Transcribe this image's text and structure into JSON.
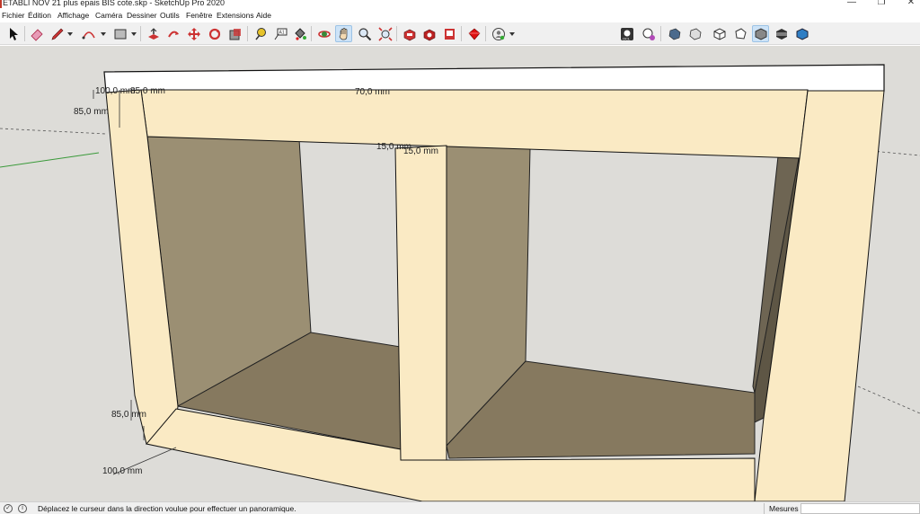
{
  "window": {
    "title": "ETABLI NOV 21 plus epais BIS cote.skp - SketchUp Pro 2020",
    "minimize": "—",
    "restore": "❐",
    "close": "✕"
  },
  "menu": [
    "Fichier",
    "Édition",
    "Affichage",
    "Caméra",
    "Dessiner",
    "Outils",
    "Fenêtre",
    "Extensions",
    "Aide"
  ],
  "toolbar": {
    "tools": [
      "select-icon",
      "eraser-icon",
      "pencil-icon",
      "arc-icon",
      "rectangle-icon",
      "push-pull-icon",
      "move-icon",
      "rotate-icon",
      "scale-icon",
      "tape-measure-icon",
      "text-icon",
      "paint-bucket-icon",
      "orbit-icon",
      "pan-icon",
      "zoom-icon",
      "zoom-extents-icon",
      "warehouse-icon",
      "extension-warehouse-icon",
      "layout-icon",
      "ruby-icon",
      "account-icon",
      "styles-icon",
      "color-icon",
      "view-iso-icon",
      "view-top-icon",
      "view-front-icon",
      "view-right-icon",
      "view-back-icon",
      "view-left-icon",
      "view-bottom-icon"
    ],
    "active_tool": "pan-icon"
  },
  "dimensions": {
    "top_left_a": "100,0 mm",
    "top_left_b": "85,0 mm",
    "top_center": "70,0 mm",
    "left_upper": "85,0 mm",
    "middle_a": "15,0 mm",
    "middle_b": "15,0 mm",
    "left_lower": "85,0 mm",
    "bottom_left": "100,0 mm"
  },
  "status": {
    "message": "Déplacez le curseur dans la direction voulue pour effectuer un panoramique.",
    "measures_label": "Mesures",
    "measures_value": ""
  },
  "colors": {
    "wood": "#faeac4",
    "inner_dark": "#8a7e68",
    "inner_mid": "#9b8f73",
    "background": "#dddcd8",
    "top_slab": "#ffffff"
  }
}
